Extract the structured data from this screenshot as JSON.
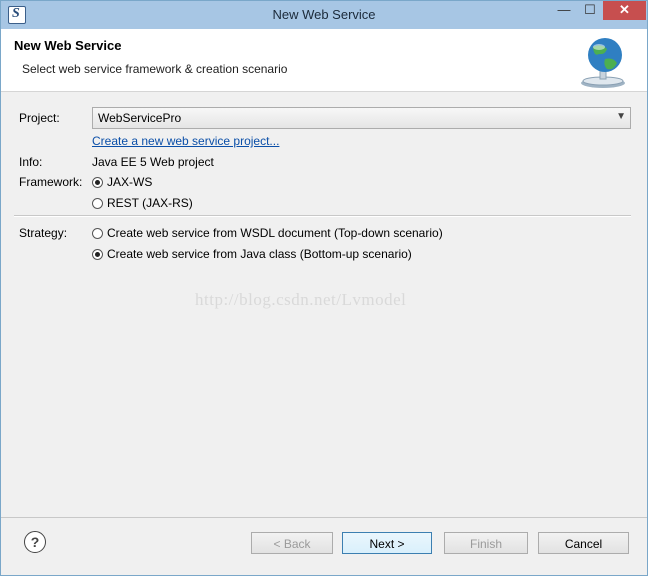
{
  "window": {
    "title": "New Web Service",
    "app_icon_glyph": "S",
    "minimize_glyph": "—",
    "maximize_glyph": "☐",
    "close_glyph": "✕"
  },
  "header": {
    "title": "New Web Service",
    "subtitle": "Select web service framework & creation scenario",
    "icon": "globe-icon"
  },
  "form": {
    "project_label": "Project:",
    "project_value": "WebServicePro",
    "create_link": "Create a new web service project...",
    "info_label": "Info:",
    "info_value": "Java EE 5 Web project",
    "framework_label": "Framework:",
    "framework_options": [
      {
        "label": "JAX-WS",
        "selected": true
      },
      {
        "label": "REST (JAX-RS)",
        "selected": false
      }
    ],
    "strategy_label": "Strategy:",
    "strategy_options": [
      {
        "label": "Create web service from WSDL document (Top-down scenario)",
        "selected": false
      },
      {
        "label": "Create web service from Java class (Bottom-up scenario)",
        "selected": true
      }
    ]
  },
  "watermark": "http://blog.csdn.net/Lvmodel",
  "footer": {
    "help_glyph": "?",
    "back_label": "< Back",
    "next_label": "Next >",
    "finish_label": "Finish",
    "cancel_label": "Cancel"
  },
  "colors": {
    "titlebar": "#a7c6e4",
    "close": "#c74f4f",
    "link": "#0b4fa8",
    "default_border": "#3c7fb1"
  }
}
